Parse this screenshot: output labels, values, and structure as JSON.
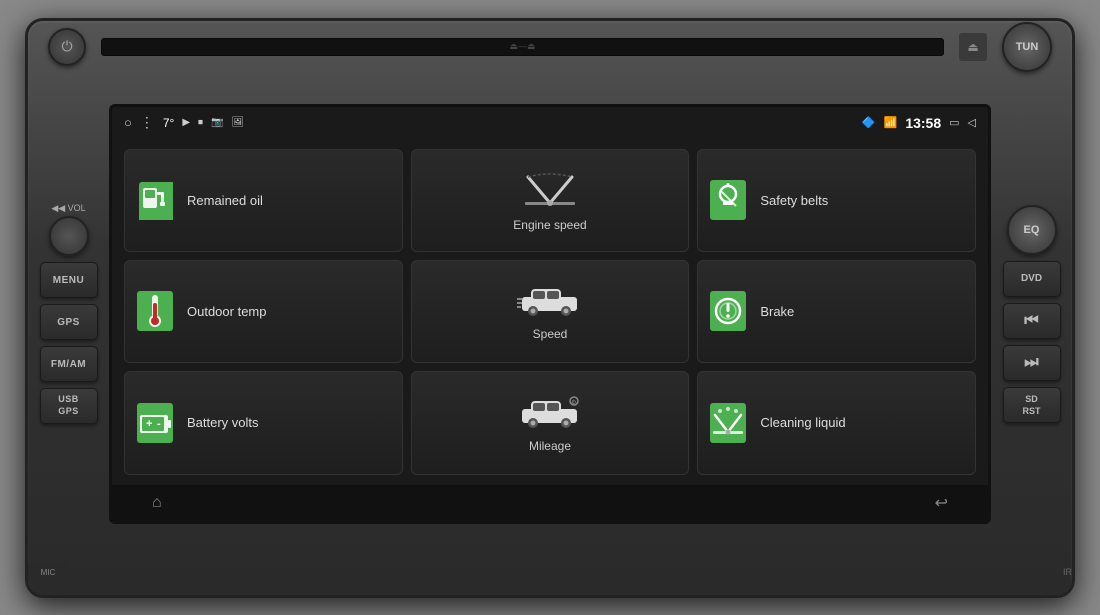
{
  "radio": {
    "top": {
      "power_label": "⏻",
      "disc_slot_label": "⏏",
      "tun_label": "TUN"
    },
    "left_buttons": [
      {
        "id": "vol",
        "label": "VOL",
        "is_knob": true
      },
      {
        "id": "menu",
        "label": "MENU"
      },
      {
        "id": "gps",
        "label": "GPS"
      },
      {
        "id": "fmam",
        "label": "FM/AM"
      },
      {
        "id": "usbgps",
        "label": "USB\nGPS"
      }
    ],
    "right_buttons": [
      {
        "id": "eq",
        "label": "EQ",
        "is_knob": true
      },
      {
        "id": "dvd",
        "label": "DVD"
      },
      {
        "id": "prev",
        "label": "⏮"
      },
      {
        "id": "next",
        "label": "⏭"
      },
      {
        "id": "sdrst",
        "label": "SD\nRST"
      }
    ],
    "bottom": {
      "mic_label": "MIC",
      "ir_label": "IR"
    }
  },
  "screen": {
    "status_bar": {
      "circle_icon": "○",
      "dots_icon": "⋮",
      "temperature": "7°",
      "media_icons": [
        "▶",
        "⏹",
        "📷",
        "✉"
      ],
      "bluetooth_icon": "🔵",
      "wifi_icon": "📶",
      "time": "13:58",
      "rect_icon": "▭",
      "back_icon": "◁"
    },
    "grid": {
      "tiles": [
        {
          "id": "remained-oil",
          "type": "regular",
          "icon": "⛽",
          "icon_type": "gas",
          "label": "Remained oil",
          "position": "top-left"
        },
        {
          "id": "engine-speed",
          "type": "center",
          "icon": "wiper",
          "label": "Engine speed",
          "position": "top-center"
        },
        {
          "id": "safety-belts",
          "type": "regular",
          "icon": "🔔",
          "icon_type": "belt",
          "label": "Safety belts",
          "position": "top-right"
        },
        {
          "id": "outdoor-temp",
          "type": "regular",
          "icon": "🌡",
          "icon_type": "temp",
          "label": "Outdoor temp",
          "position": "mid-left"
        },
        {
          "id": "speed",
          "type": "center",
          "icon": "car",
          "label": "Speed",
          "position": "mid-center"
        },
        {
          "id": "brake",
          "type": "regular",
          "icon": "⚠",
          "icon_type": "brake",
          "label": "Brake",
          "position": "mid-right"
        },
        {
          "id": "battery-volts",
          "type": "regular",
          "icon": "🔋",
          "icon_type": "battery",
          "label": "Battery volts",
          "position": "bot-left"
        },
        {
          "id": "mileage",
          "type": "center",
          "icon": "car-small",
          "label": "Mileage",
          "position": "bot-center"
        },
        {
          "id": "cleaning-liquid",
          "type": "regular",
          "icon": "🌊",
          "icon_type": "wiper",
          "label": "Cleaning liquid",
          "position": "bot-right"
        }
      ]
    },
    "bottom_nav": {
      "home_icon": "⌂",
      "back_icon": "↩"
    }
  },
  "colors": {
    "green": "#4caf50",
    "dark_bg": "#1a1a1a",
    "tile_bg": "#252525",
    "screen_bg": "#111"
  }
}
